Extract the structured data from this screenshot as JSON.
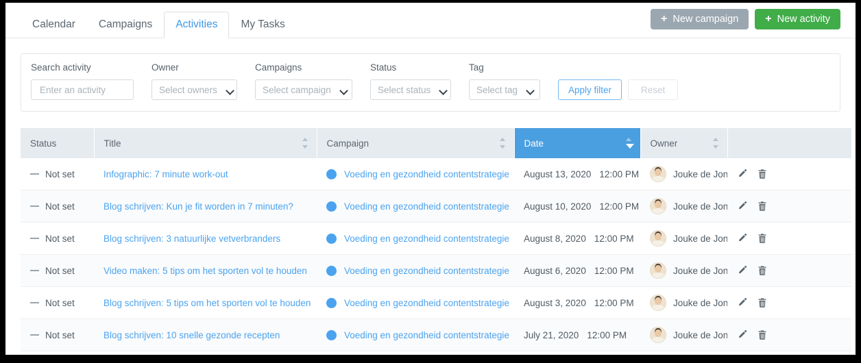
{
  "tabs": [
    {
      "label": "Calendar",
      "active": false
    },
    {
      "label": "Campaigns",
      "active": false
    },
    {
      "label": "Activities",
      "active": true
    },
    {
      "label": "My Tasks",
      "active": false
    }
  ],
  "header_buttons": {
    "new_campaign": "New campaign",
    "new_activity": "New activity",
    "plus": "+",
    "new_campaign_color": "#9aa7b0",
    "new_activity_color": "#41ad49"
  },
  "filters": {
    "search": {
      "label": "Search activity",
      "placeholder": "Enter an activity",
      "value": ""
    },
    "owner": {
      "label": "Owner",
      "value": "Select owners"
    },
    "campaigns": {
      "label": "Campaigns",
      "value": "Select campaign"
    },
    "status": {
      "label": "Status",
      "value": "Select status"
    },
    "tag": {
      "label": "Tag",
      "value": "Select tag"
    },
    "apply_label": "Apply filter",
    "reset_label": "Reset"
  },
  "table": {
    "columns": [
      {
        "label": "Status",
        "sortable": false,
        "sorted": false
      },
      {
        "label": "Title",
        "sortable": true,
        "sorted": false
      },
      {
        "label": "Campaign",
        "sortable": true,
        "sorted": false
      },
      {
        "label": "Date",
        "sortable": true,
        "sorted": true,
        "direction": "desc"
      },
      {
        "label": "Owner",
        "sortable": true,
        "sorted": false
      },
      {
        "label": "",
        "sortable": false,
        "sorted": false
      }
    ],
    "sorted_column_color": "#4a9fe0",
    "campaign_dot_color": "#4ba3ef",
    "link_color": "#4ba3ef",
    "rows": [
      {
        "status": "Not set",
        "title": "Infographic: 7 minute work-out",
        "campaign": "Voeding en gezondheid contentstrategie",
        "date": "August 13, 2020",
        "time": "12:00 PM",
        "owner": "Jouke de Jong"
      },
      {
        "status": "Not set",
        "title": "Blog schrijven: Kun je fit worden in 7 minuten?",
        "campaign": "Voeding en gezondheid contentstrategie",
        "date": "August 10, 2020",
        "time": "12:00 PM",
        "owner": "Jouke de Jong"
      },
      {
        "status": "Not set",
        "title": "Blog schrijven: 3 natuurlijke vetverbranders",
        "campaign": "Voeding en gezondheid contentstrategie",
        "date": "August 8, 2020",
        "time": "12:00 PM",
        "owner": "Jouke de Jong"
      },
      {
        "status": "Not set",
        "title": "Video maken: 5 tips om het sporten vol te houden",
        "campaign": "Voeding en gezondheid contentstrategie",
        "date": "August 6, 2020",
        "time": "12:00 PM",
        "owner": "Jouke de Jong"
      },
      {
        "status": "Not set",
        "title": "Blog schrijven: 5 tips om het sporten vol te houden",
        "campaign": "Voeding en gezondheid contentstrategie",
        "date": "August 3, 2020",
        "time": "12:00 PM",
        "owner": "Jouke de Jong"
      },
      {
        "status": "Not set",
        "title": "Blog schrijven: 10 snelle gezonde recepten",
        "campaign": "Voeding en gezondheid contentstrategie",
        "date": "July 21, 2020",
        "time": "12:00 PM",
        "owner": "Jouke de Jong"
      }
    ]
  }
}
